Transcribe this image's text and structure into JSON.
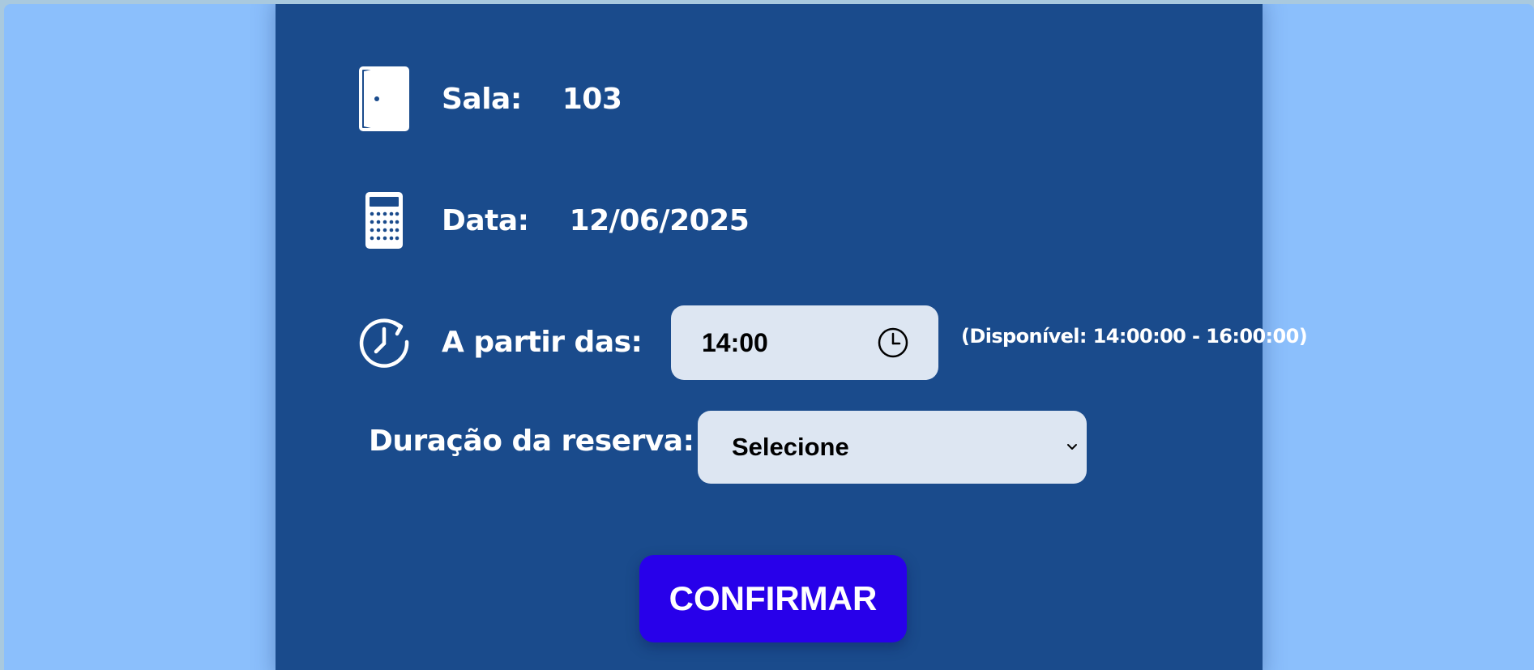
{
  "reservation": {
    "room_label": "Sala:",
    "room_value": "103",
    "date_label": "Data:",
    "date_value": "12/06/2025",
    "start_label": "A partir das:",
    "start_time_value": "14:00",
    "availability_text": "(Disponível: 14:00:00 - 16:00:00)",
    "duration_label": "Duração da reserva:",
    "duration_selected": "Selecione",
    "confirm_label": "CONFIRMAR"
  },
  "icons": {
    "room": "door-icon",
    "date": "calculator-icon",
    "time": "clock-history-icon",
    "time_picker": "clock-icon",
    "select": "chevron-down-icon"
  },
  "colors": {
    "page_background": "#8bbffc",
    "card_background": "#1a4b8c",
    "input_background": "#dde6f2",
    "confirm_button": "#2800ea",
    "text_light": "#ffffff"
  }
}
